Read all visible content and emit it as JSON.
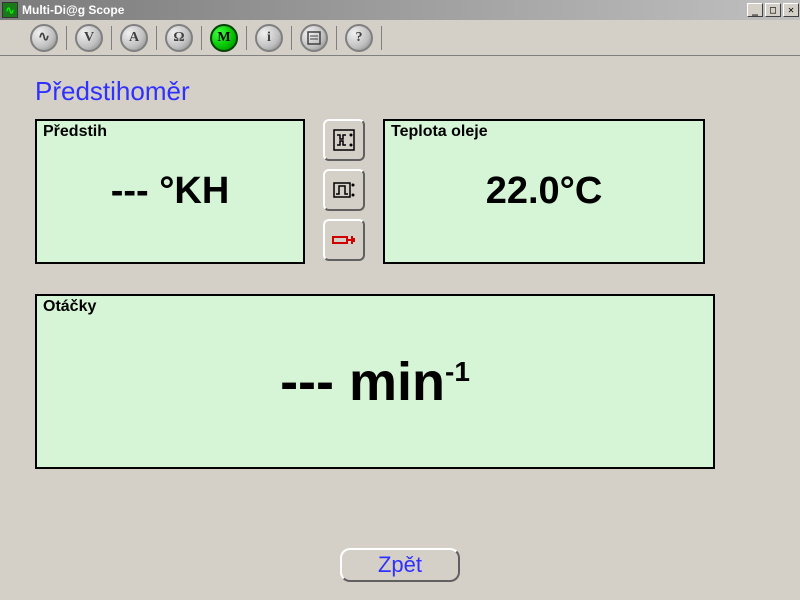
{
  "window": {
    "title": "Multi-Di@g Scope"
  },
  "toolbar": {
    "osc": "∿",
    "volt": "V",
    "amp": "A",
    "ohm": "Ω",
    "motor": "M",
    "info": "i",
    "report": "⍰",
    "help": "?"
  },
  "page_title": "Předstihoměr",
  "panels": {
    "predstih_label": "Předstih",
    "predstih_value": "--- °KH",
    "teplota_label": "Teplota oleje",
    "teplota_value": "22.0°C",
    "otacky_label": "Otáčky",
    "otacky_value": "---  min",
    "otacky_sup": "-1"
  },
  "buttons": {
    "back": "Zpět"
  }
}
